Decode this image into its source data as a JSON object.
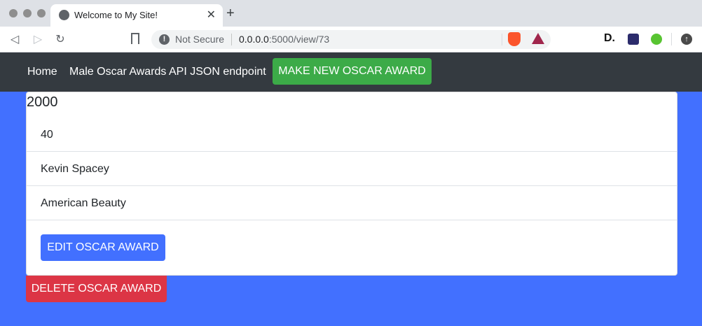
{
  "browser": {
    "tab_title": "Welcome to My Site!",
    "close_glyph": "✕",
    "new_tab_glyph": "+",
    "security_label": "Not Secure",
    "url_host": "0.0.0.0",
    "url_rest": ":5000/view/73",
    "info_glyph": "!",
    "back_glyph": "◁",
    "forward_glyph": "▷",
    "reload_glyph": "↻",
    "ext_d_label": "D.",
    "update_glyph": "↑"
  },
  "navbar": {
    "home_label": "Home",
    "api_label": "Male Oscar Awards API JSON endpoint",
    "new_award_label": "MAKE NEW OSCAR AWARD"
  },
  "award": {
    "year": "2000",
    "age": "40",
    "name": "Kevin Spacey",
    "movie": "American Beauty"
  },
  "actions": {
    "edit_label": "EDIT OSCAR AWARD",
    "delete_label": "DELETE OSCAR AWARD"
  },
  "colors": {
    "page_background": "#4270ff",
    "navbar": "#343a40",
    "primary": "#4270ff",
    "success": "#3cab48",
    "danger": "#dc3545"
  }
}
